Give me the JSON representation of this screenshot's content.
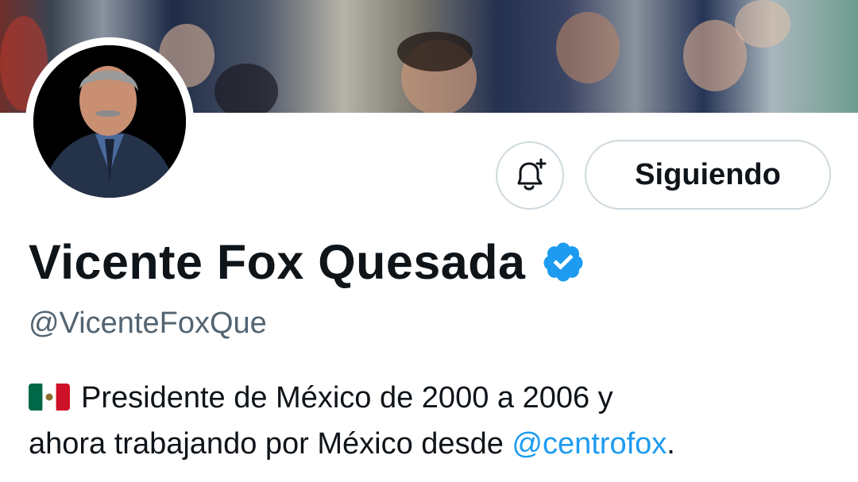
{
  "profile": {
    "display_name": "Vicente Fox Quesada",
    "handle": "@VicenteFoxQue",
    "bio": {
      "text_line1": "Presidente de México de 2000 a 2006 y",
      "text_line2_prefix": "ahora trabajando por México desde ",
      "mention": "@centrofox",
      "text_line2_suffix": "."
    }
  },
  "actions": {
    "follow_label": "Siguiendo"
  },
  "icons": {
    "bell": "bell-plus-icon",
    "verified": "verified-badge-icon",
    "flag": "mexico-flag-icon"
  },
  "colors": {
    "link": "#1d9bf0",
    "verified": "#1d9bf0",
    "text_primary": "#0f1419",
    "text_secondary": "#536471",
    "border": "#cfd9de"
  }
}
